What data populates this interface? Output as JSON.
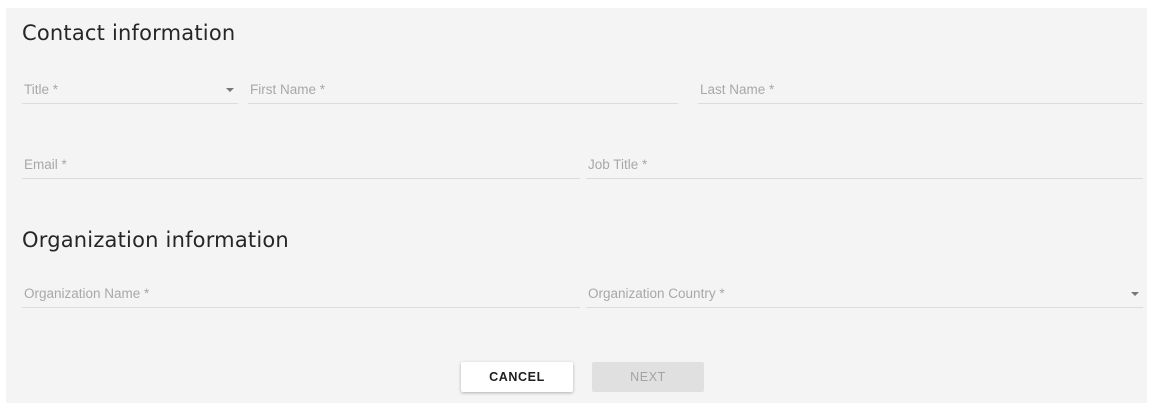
{
  "contact": {
    "heading": "Contact information",
    "title_label": "Title *",
    "first_name_label": "First Name *",
    "last_name_label": "Last Name *",
    "email_label": "Email *",
    "job_title_label": "Job Title *"
  },
  "organization": {
    "heading": "Organization information",
    "name_label": "Organization Name *",
    "country_label": "Organization Country *"
  },
  "actions": {
    "cancel_label": "CANCEL",
    "next_label": "NEXT"
  },
  "icons": {
    "title_dropdown": "chevron-down-icon",
    "country_dropdown": "chevron-down-icon"
  }
}
